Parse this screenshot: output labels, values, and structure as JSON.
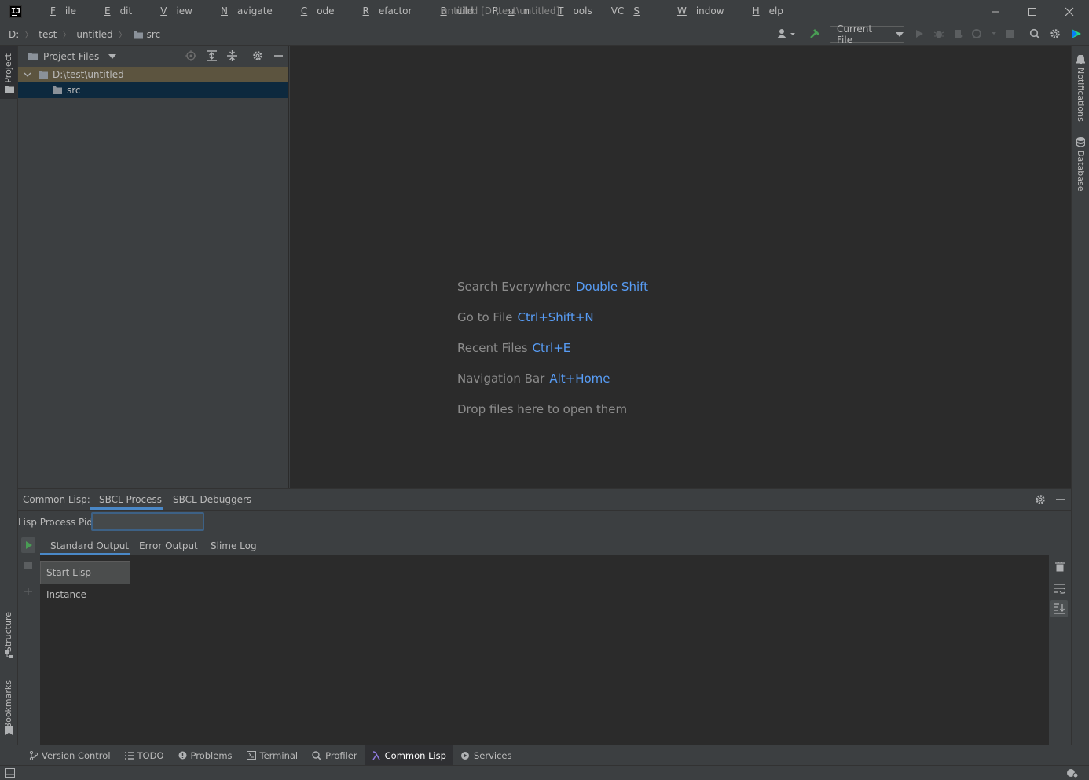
{
  "window": {
    "title": "untitled [D:\\test\\untitled]",
    "logo": "IJ"
  },
  "menu": [
    {
      "pre": "",
      "ul": "F",
      "post": "ile"
    },
    {
      "pre": "",
      "ul": "E",
      "post": "dit"
    },
    {
      "pre": "",
      "ul": "V",
      "post": "iew"
    },
    {
      "pre": "",
      "ul": "N",
      "post": "avigate"
    },
    {
      "pre": "",
      "ul": "C",
      "post": "ode"
    },
    {
      "pre": "",
      "ul": "R",
      "post": "efactor"
    },
    {
      "pre": "",
      "ul": "B",
      "post": "uild"
    },
    {
      "pre": "R",
      "ul": "u",
      "post": "n"
    },
    {
      "pre": "",
      "ul": "T",
      "post": "ools"
    },
    {
      "pre": "VC",
      "ul": "S",
      "post": ""
    },
    {
      "pre": "",
      "ul": "W",
      "post": "indow"
    },
    {
      "pre": "",
      "ul": "H",
      "post": "elp"
    }
  ],
  "breadcrumbs": [
    "D:",
    "test",
    "untitled",
    "src"
  ],
  "toolbar": {
    "run_config": "Current File"
  },
  "left_stripe": {
    "project": "Project",
    "structure": "Structure",
    "bookmarks": "Bookmarks"
  },
  "right_stripe": {
    "notifications": "Notifications",
    "database": "Database"
  },
  "project_panel": {
    "view_label": "Project Files",
    "tree": [
      {
        "label": "D:\\test\\untitled"
      },
      {
        "label": "src"
      }
    ]
  },
  "editor": {
    "hints": [
      {
        "text": "Search Everywhere",
        "key": "Double Shift"
      },
      {
        "text": "Go to File",
        "key": "Ctrl+Shift+N"
      },
      {
        "text": "Recent Files",
        "key": "Ctrl+E"
      },
      {
        "text": "Navigation Bar",
        "key": "Alt+Home"
      },
      {
        "text": "Drop files here to open them",
        "key": ""
      }
    ]
  },
  "tool_window": {
    "title": "Common Lisp:",
    "tabs": [
      "SBCL Process",
      "SBCL Debuggers"
    ],
    "pid_label": "Lisp Process Pid:",
    "pid_value": "",
    "output_tabs": [
      "Standard Output",
      "Error Output",
      "Slime Log"
    ],
    "tooltip": "Start Lisp Instance"
  },
  "bottom_tabs": [
    {
      "label": "Version Control",
      "icon": "branch-icon"
    },
    {
      "label": "TODO",
      "icon": "list-icon"
    },
    {
      "label": "Problems",
      "icon": "warning-icon"
    },
    {
      "label": "Terminal",
      "icon": "terminal-icon"
    },
    {
      "label": "Profiler",
      "icon": "profiler-icon"
    },
    {
      "label": "Common Lisp",
      "icon": "lambda-icon"
    },
    {
      "label": "Services",
      "icon": "services-icon"
    }
  ],
  "colors": {
    "accent": "#4a88c7",
    "editor_bg": "#2b2b2b",
    "panel_bg": "#3c3f41",
    "selection": "#0d293e",
    "key_hint": "#589df6",
    "run_green": "#499c54"
  }
}
